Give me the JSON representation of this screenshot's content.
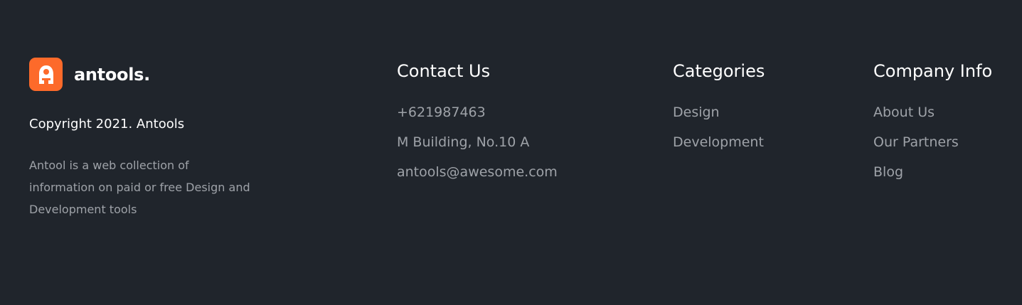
{
  "brand": {
    "logo_text": "antools.",
    "logo_color": "#fd6a2a",
    "copyright": "Copyright 2021. Antools",
    "description": "Antool is a web collection of information on paid or free Design and Development tools"
  },
  "contact": {
    "title": "Contact Us",
    "items": [
      "+621987463",
      "M Building, No.10 A",
      "antools@awesome.com"
    ]
  },
  "categories": {
    "title": "Categories",
    "items": [
      "Design",
      "Development"
    ]
  },
  "company": {
    "title": "Company Info",
    "items": [
      "About Us",
      "Our Partners",
      "Blog"
    ]
  },
  "colors": {
    "background": "#20252c",
    "heading": "#ffffff",
    "muted": "#9ea2a8"
  }
}
